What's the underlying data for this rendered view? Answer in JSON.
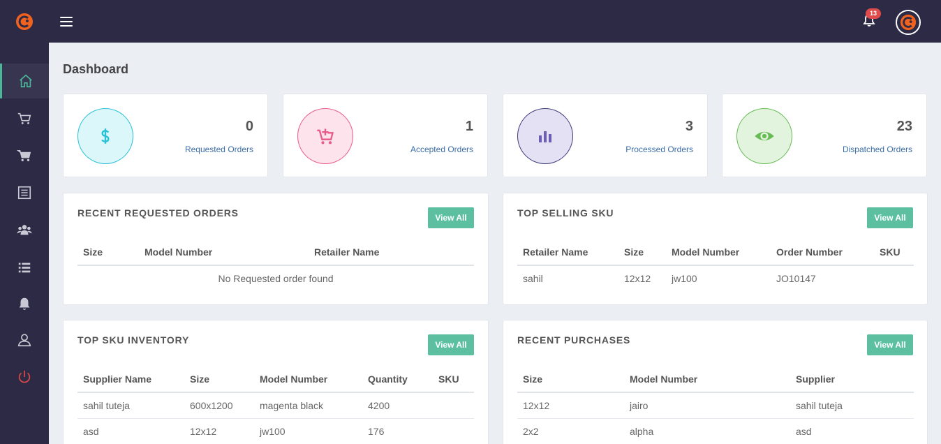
{
  "header": {
    "notification_count": "13"
  },
  "sidebar": {
    "items": [
      {
        "icon": "home-icon",
        "active": true
      },
      {
        "icon": "cart-outline-icon",
        "active": false
      },
      {
        "icon": "cart-icon",
        "active": false
      },
      {
        "icon": "list-alt-icon",
        "active": false
      },
      {
        "icon": "users-icon",
        "active": false
      },
      {
        "icon": "list-icon",
        "active": false
      },
      {
        "icon": "bell-icon",
        "active": false
      },
      {
        "icon": "user-icon",
        "active": false
      },
      {
        "icon": "power-icon",
        "active": false
      }
    ]
  },
  "page": {
    "title": "Dashboard"
  },
  "stats": [
    {
      "value": "0",
      "label": "Requested Orders",
      "icon": "dollar-icon",
      "color": "#29c0d8",
      "bg": "#dcf7fa"
    },
    {
      "value": "1",
      "label": "Accepted Orders",
      "icon": "cart-plus-icon",
      "color": "#e85a8a",
      "bg": "#fde3ec"
    },
    {
      "value": "3",
      "label": "Processed Orders",
      "icon": "bar-chart-icon",
      "color": "#6a5fb4",
      "bg": "#e3e1f3"
    },
    {
      "value": "23",
      "label": "Dispatched Orders",
      "icon": "eye-icon",
      "color": "#66bb55",
      "bg": "#e3f4de"
    }
  ],
  "panels": {
    "recent_requested": {
      "title": "RECENT REQUESTED ORDERS",
      "button": "View All",
      "columns": [
        "Size",
        "Model Number",
        "Retailer Name"
      ],
      "empty": "No Requested order found"
    },
    "top_selling": {
      "title": "TOP SELLING SKU",
      "button": "View All",
      "columns": [
        "Retailer Name",
        "Size",
        "Model Number",
        "Order Number",
        "SKU"
      ],
      "rows": [
        [
          "sahil",
          "12x12",
          "jw100",
          "JO10147",
          ""
        ]
      ]
    },
    "top_inventory": {
      "title": "TOP SKU INVENTORY",
      "button": "View All",
      "columns": [
        "Supplier Name",
        "Size",
        "Model Number",
        "Quantity",
        "SKU"
      ],
      "rows": [
        [
          "sahil tuteja",
          "600x1200",
          "magenta black",
          "4200",
          ""
        ],
        [
          "asd",
          "12x12",
          "jw100",
          "176",
          ""
        ]
      ]
    },
    "recent_purchases": {
      "title": "RECENT PURCHASES",
      "button": "View All",
      "columns": [
        "Size",
        "Model Number",
        "Supplier"
      ],
      "rows": [
        [
          "12x12",
          "jairo",
          "sahil tuteja"
        ],
        [
          "2x2",
          "alpha",
          "asd"
        ]
      ]
    }
  }
}
